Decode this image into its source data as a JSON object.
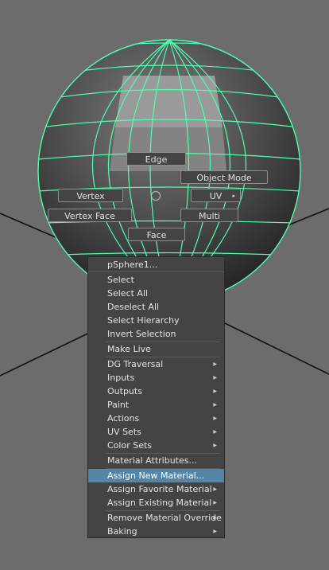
{
  "marking_menu": {
    "edge": "Edge",
    "object_mode": "Object Mode",
    "vertex": "Vertex",
    "uv": "UV",
    "vertex_face": "Vertex Face",
    "multi": "Multi",
    "face": "Face"
  },
  "context_menu": {
    "title": "pSphere1...",
    "items": [
      {
        "label": "Select",
        "submenu": false
      },
      {
        "label": "Select All",
        "submenu": false
      },
      {
        "label": "Deselect All",
        "submenu": false
      },
      {
        "label": "Select Hierarchy",
        "submenu": false
      },
      {
        "label": "Invert Selection",
        "submenu": false
      },
      {
        "label": "Make Live",
        "submenu": false
      },
      {
        "label": "DG Traversal",
        "submenu": true
      },
      {
        "label": "Inputs",
        "submenu": true
      },
      {
        "label": "Outputs",
        "submenu": true
      },
      {
        "label": "Paint",
        "submenu": true
      },
      {
        "label": "Actions",
        "submenu": true
      },
      {
        "label": "UV Sets",
        "submenu": true
      },
      {
        "label": "Color Sets",
        "submenu": true
      },
      {
        "label": "Material Attributes...",
        "submenu": false
      },
      {
        "label": "Assign New Material...",
        "submenu": false,
        "highlighted": true
      },
      {
        "label": "Assign Favorite Material",
        "submenu": true
      },
      {
        "label": "Assign Existing Material",
        "submenu": true
      },
      {
        "label": "Remove Material Override",
        "submenu": true
      },
      {
        "label": "Baking",
        "submenu": true
      }
    ]
  },
  "colors": {
    "viewport_bg": "#6c6c6c",
    "wireframe": "#4dffb0",
    "menu_bg": "#444444",
    "highlight": "#5285a6"
  }
}
